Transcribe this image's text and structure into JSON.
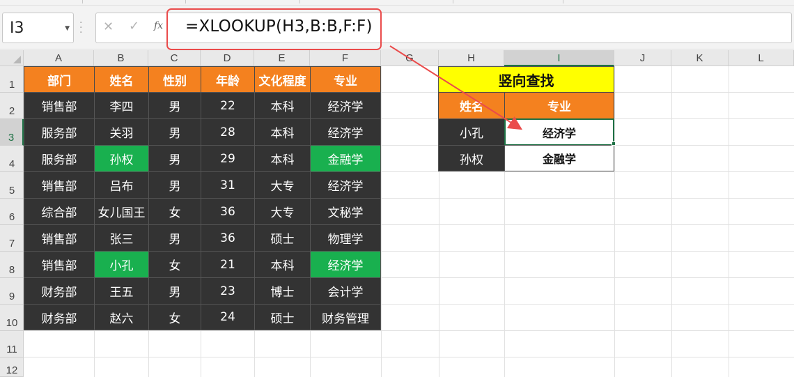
{
  "name_box": {
    "value": "I3"
  },
  "formula_bar": {
    "cancel_icon": "✕",
    "enter_icon": "✓",
    "fx_label": "fx",
    "formula": "=XLOOKUP(H3,B:B,F:F)"
  },
  "columns": [
    "A",
    "B",
    "C",
    "D",
    "E",
    "F",
    "G",
    "H",
    "I",
    "J",
    "K",
    "L"
  ],
  "rows": [
    "1",
    "2",
    "3",
    "4",
    "5",
    "6",
    "7",
    "8",
    "9",
    "10",
    "11",
    "12"
  ],
  "selected_cell": {
    "column": "I",
    "row": "3"
  },
  "source_table": {
    "headers": [
      "部门",
      "姓名",
      "性别",
      "年龄",
      "文化程度",
      "专业"
    ],
    "rows": [
      [
        "销售部",
        "李四",
        "男",
        "22",
        "本科",
        "经济学"
      ],
      [
        "服务部",
        "关羽",
        "男",
        "28",
        "本科",
        "经济学"
      ],
      [
        "服务部",
        "孙权",
        "男",
        "29",
        "本科",
        "金融学"
      ],
      [
        "销售部",
        "吕布",
        "男",
        "31",
        "大专",
        "经济学"
      ],
      [
        "综合部",
        "女儿国王",
        "女",
        "36",
        "大专",
        "文秘学"
      ],
      [
        "销售部",
        "张三",
        "男",
        "36",
        "硕士",
        "物理学"
      ],
      [
        "销售部",
        "小孔",
        "女",
        "21",
        "本科",
        "经济学"
      ],
      [
        "财务部",
        "王五",
        "男",
        "23",
        "博士",
        "会计学"
      ],
      [
        "财务部",
        "赵六",
        "女",
        "24",
        "硕士",
        "财务管理"
      ]
    ]
  },
  "lookup_table": {
    "title": "竖向查找",
    "headers": [
      "姓名",
      "专业"
    ],
    "rows": [
      [
        "小孔",
        "经济学"
      ],
      [
        "孙权",
        "金融学"
      ]
    ]
  },
  "colors": {
    "header_orange": "#f4811f",
    "dark_cell": "#333333",
    "match_green": "#19b04f",
    "title_yellow": "#ffff00",
    "annotation_red": "#ea4b4b",
    "excel_green": "#1e7145"
  }
}
